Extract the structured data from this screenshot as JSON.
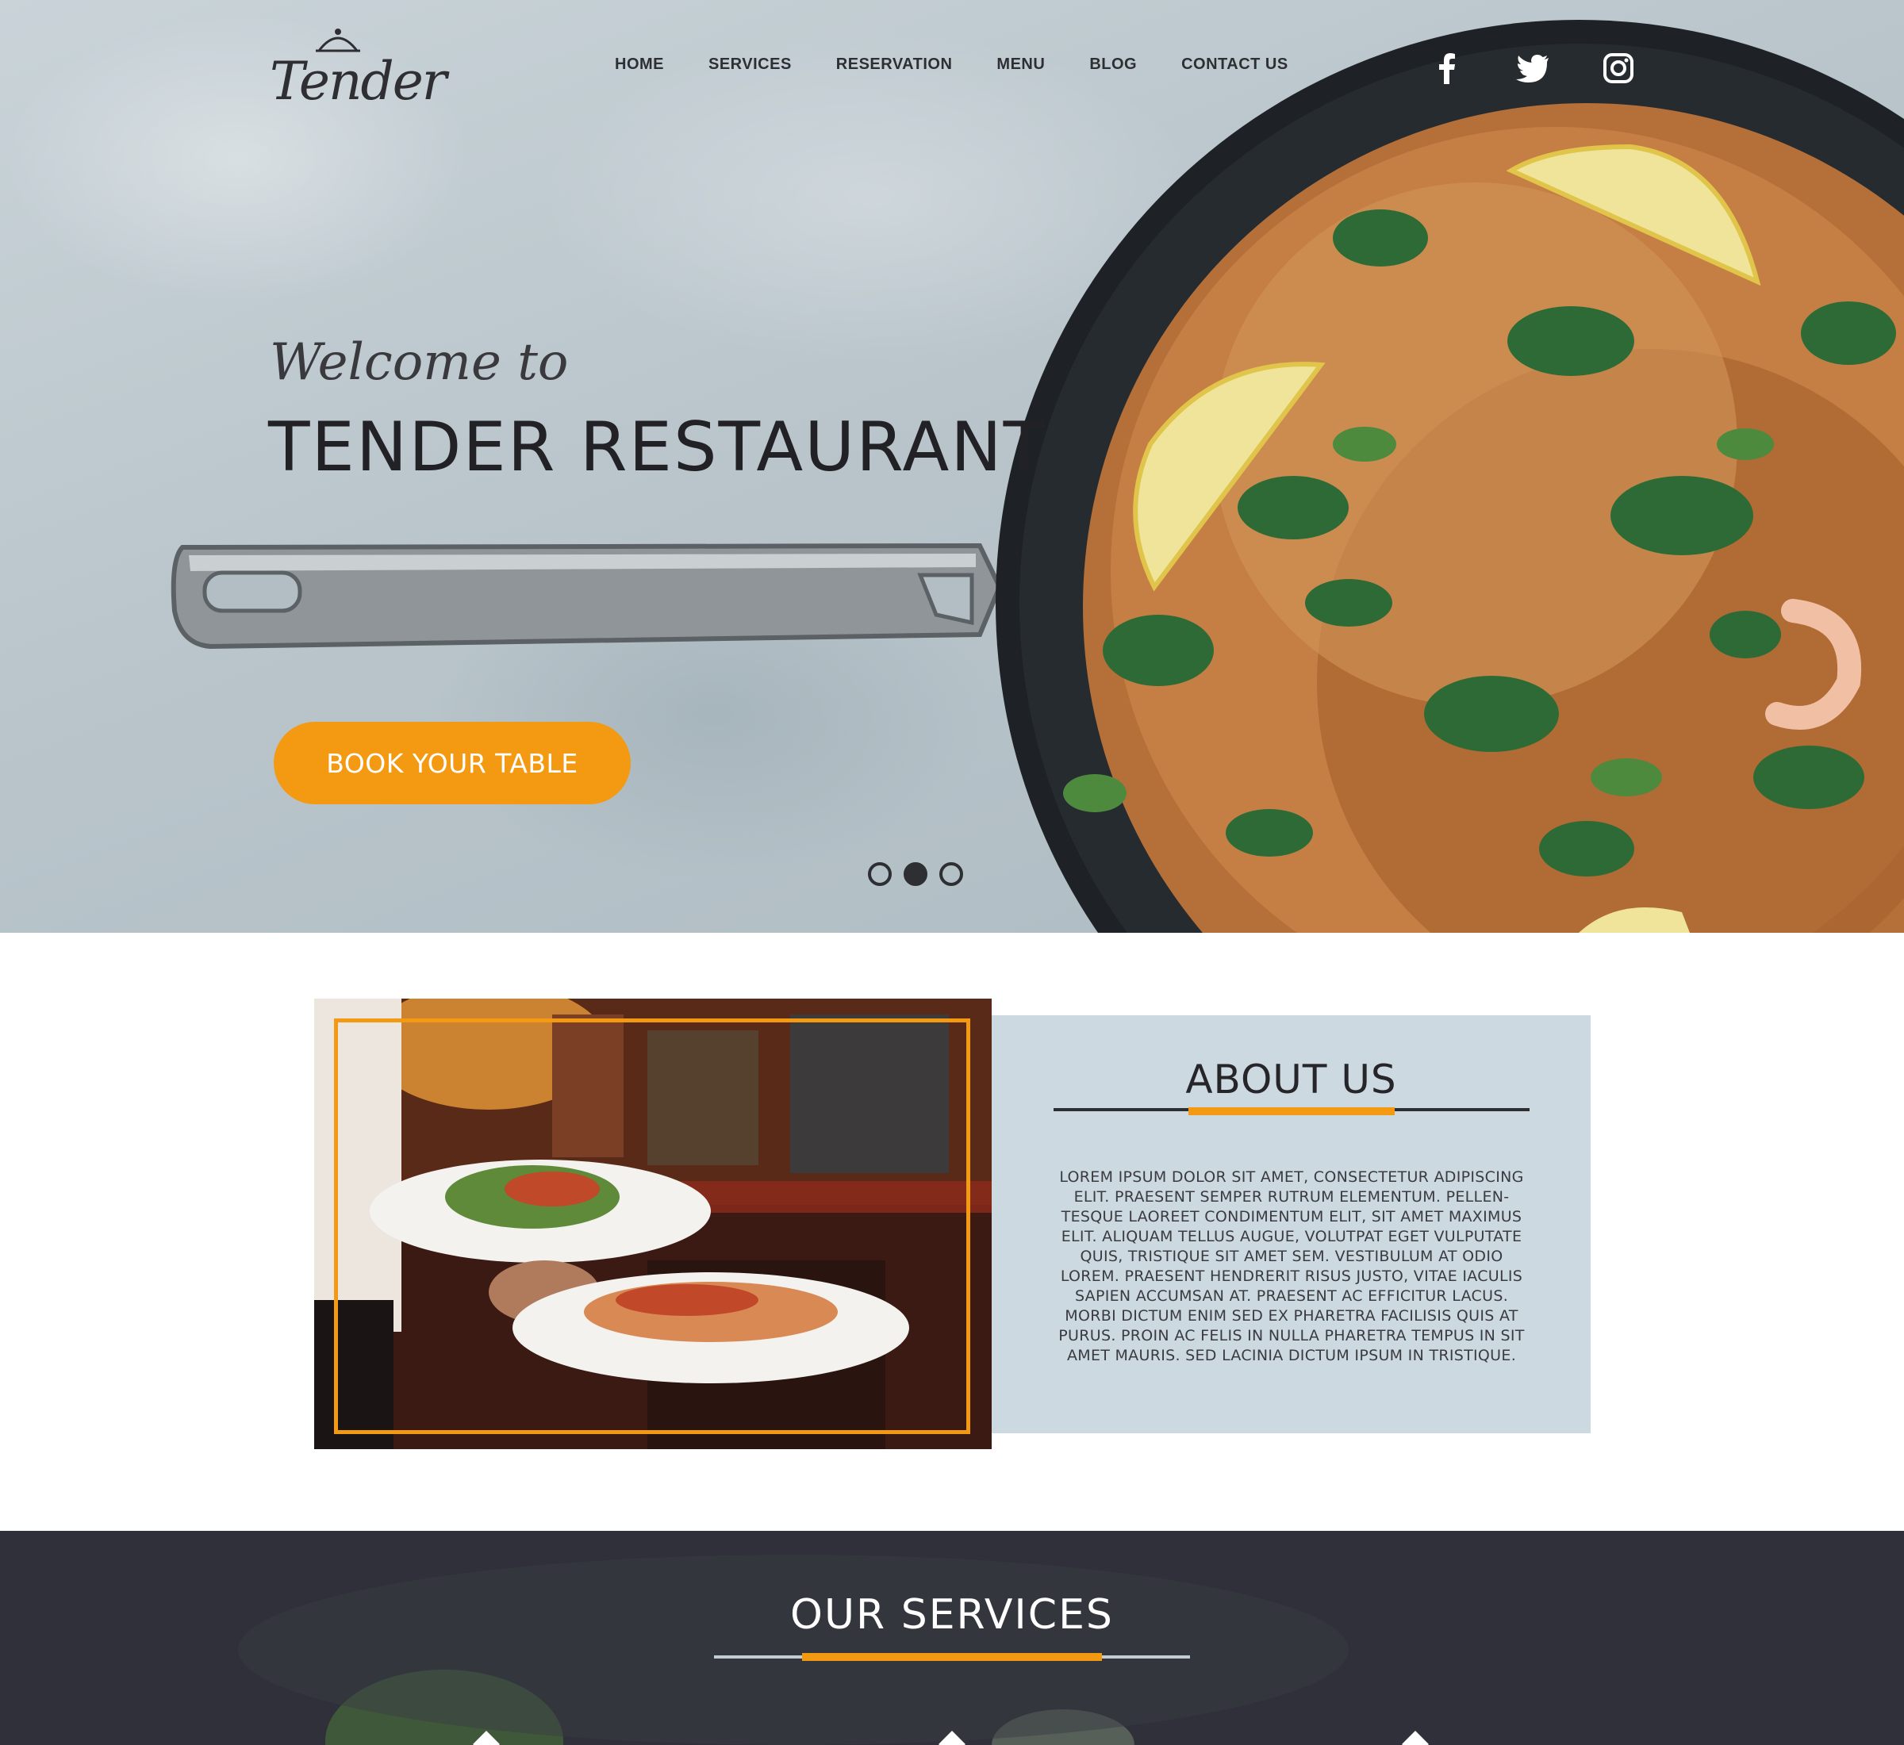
{
  "brand": {
    "logo_text": "Tender"
  },
  "nav": {
    "items": [
      "HOME",
      "SERVICES",
      "RESERVATION",
      "MENU",
      "BLOG",
      "CONTACT US"
    ]
  },
  "social": {
    "icons": [
      "facebook-icon",
      "twitter-icon",
      "instagram-icon"
    ]
  },
  "hero": {
    "welcome": "Welcome to",
    "title": "TENDER RESTAURANT",
    "cta": "BOOK YOUR TABLE",
    "slides": {
      "count": 3,
      "active_index": 1
    }
  },
  "about": {
    "title": "ABOUT US",
    "body": "LOREM IPSUM DOLOR SIT AMET, CONSECTETUR ADIPISCING ELIT. PRAESENT SEMPER RUTRUM ELEMENTUM. PELLEN-TESQUE LAOREET CONDIMENTUM ELIT, SIT AMET MAXIMUS ELIT. ALIQUAM TELLUS AUGUE, VOLUTPAT EGET VULPUTATE QUIS, TRISTIQUE SIT AMET SEM. VESTIBULUM AT ODIO LOREM. PRAESENT HENDRERIT RISUS JUSTO, VITAE IACULIS SAPIEN ACCUMSAN AT. PRAESENT AC EFFICITUR LACUS. MORBI DICTUM ENIM SED EX PHARETRA FACILISIS QUIS AT PURUS. PROIN AC FELIS IN NULLA PHARETRA TEMPUS IN SIT AMET MAURIS. SED LACINIA DICTUM IPSUM IN TRISTIQUE."
  },
  "services": {
    "title": "OUR SERVICES"
  },
  "colors": {
    "accent": "#f39a12",
    "dark": "#2f3039",
    "about_bg": "#cdd9e0",
    "text_dark": "#222226"
  }
}
